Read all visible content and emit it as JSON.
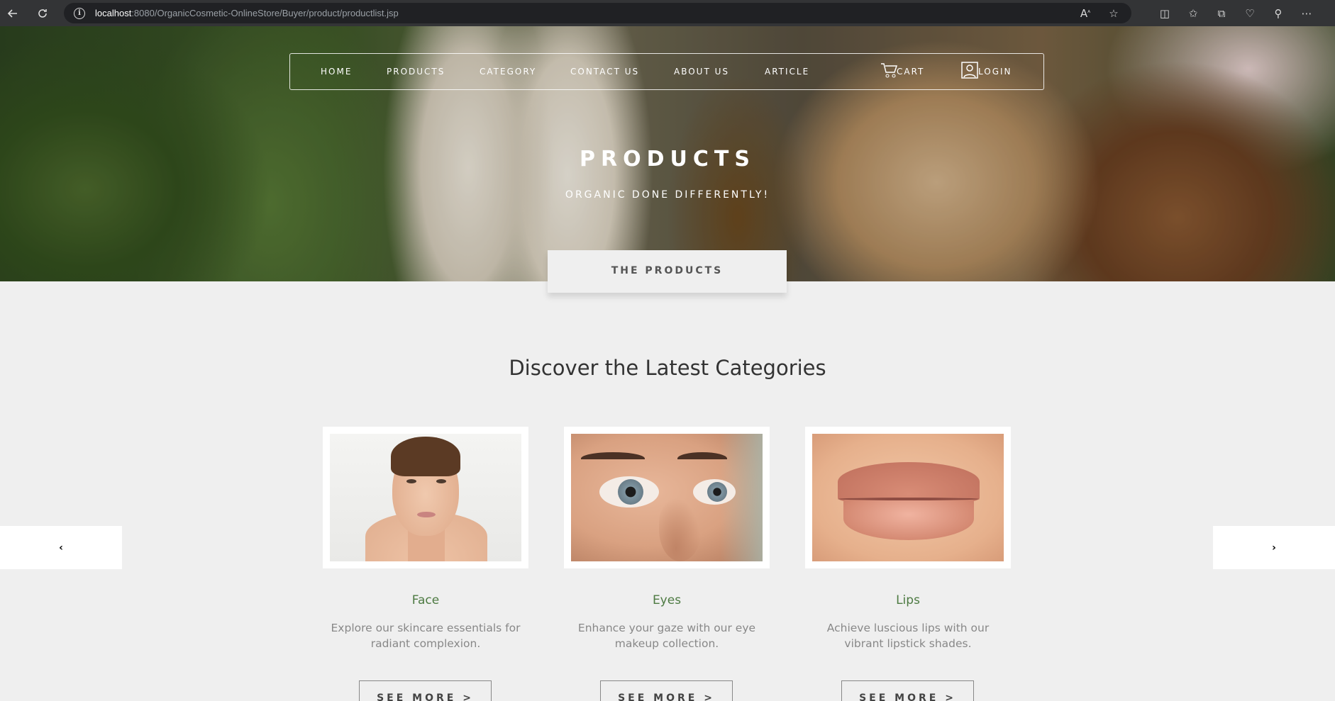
{
  "browser": {
    "url_host": "localhost",
    "url_rest": ":8080/OrganicCosmetic-OnlineStore/Buyer/product/productlist.jsp"
  },
  "nav": {
    "items": [
      "HOME",
      "PRODUCTS",
      "CATEGORY",
      "CONTACT US",
      "ABOUT US",
      "ARTICLE"
    ],
    "cart": "CART",
    "login": "LOGIN"
  },
  "hero": {
    "title": "PRODUCTS",
    "subtitle": "ORGANIC DONE DIFFERENTLY!"
  },
  "tab": {
    "label": "THE PRODUCTS"
  },
  "section": {
    "title": "Discover the Latest Categories"
  },
  "carousel": {
    "prev": "‹",
    "next": "›",
    "cards": [
      {
        "name": "Face",
        "desc": "Explore our skincare essentials for radiant complexion.",
        "button": "SEE MORE >"
      },
      {
        "name": "Eyes",
        "desc": "Enhance your gaze with our eye makeup collection.",
        "button": "SEE MORE >"
      },
      {
        "name": "Lips",
        "desc": "Achieve luscious lips with our vibrant lipstick shades.",
        "button": "SEE MORE >"
      }
    ]
  },
  "colors": {
    "accent_green": "#4d7a42",
    "page_bg": "#efefef"
  }
}
